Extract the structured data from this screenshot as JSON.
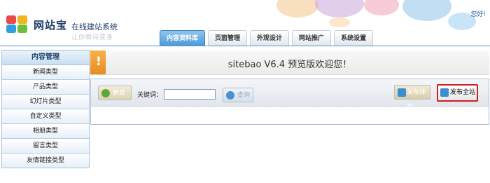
{
  "header": {
    "brand": "网站宝",
    "tagline": "在线建站系统",
    "slogan": "让你瞬间变身",
    "greeting": "您好!"
  },
  "nav": {
    "tabs": [
      {
        "label": "内容资料库",
        "active": true
      },
      {
        "label": "页面管理",
        "active": false
      },
      {
        "label": "外观设计",
        "active": false
      },
      {
        "label": "网站推广",
        "active": false
      },
      {
        "label": "系统设置",
        "active": false
      }
    ]
  },
  "sidebar": {
    "title": "内容管理",
    "items": [
      {
        "label": "新闻类型"
      },
      {
        "label": "产品类型"
      },
      {
        "label": "幻灯片类型"
      },
      {
        "label": "自定义类型"
      },
      {
        "label": "相册类型"
      },
      {
        "label": "留言类型"
      },
      {
        "label": "友情链接类型"
      }
    ]
  },
  "main": {
    "welcome": "sitebao V6.4 预览版欢迎您！",
    "toolbar": {
      "new_label": "新建",
      "keyword_label": "关键词：",
      "search_value": "",
      "query_label": "查询",
      "publish_type_label": "发布排类",
      "publish_all_label": "发布全站"
    }
  },
  "colors": {
    "accent": "#4c98d4",
    "highlight_border": "#d41e1e",
    "banner_mark": "#e98b1c"
  }
}
